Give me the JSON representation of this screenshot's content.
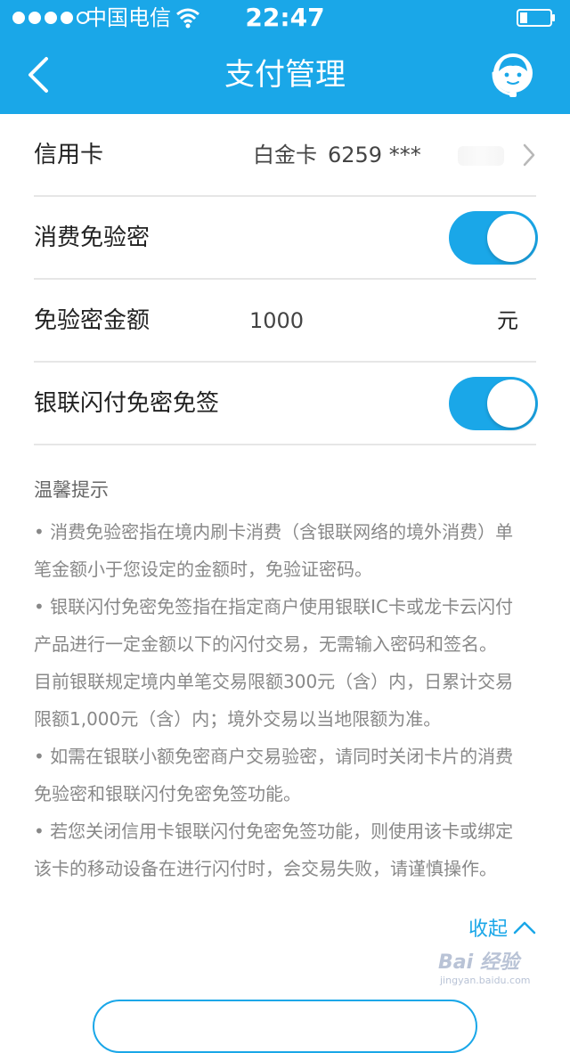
{
  "status_bar": {
    "carrier": "中国电信",
    "time": "22:47"
  },
  "nav": {
    "title": "支付管理",
    "back_icon": "chevron-left-icon",
    "service_icon": "customer-service-icon"
  },
  "settings": {
    "credit_card": {
      "label": "信用卡",
      "card_type": "白金卡",
      "card_number": "6259 ***"
    },
    "no_pin": {
      "label": "消费免验密",
      "enabled": true
    },
    "amount": {
      "label": "免验密金额",
      "value": "1000",
      "unit": "元"
    },
    "quickpass": {
      "label": "银联闪付免密免签",
      "enabled": true
    }
  },
  "tips": {
    "title": "温馨提示",
    "lines": [
      "• 消费免验密指在境内刷卡消费（含银联网络的境外消费）单",
      "笔金额小于您设定的金额时，免验证密码。",
      "• 银联闪付免密免签指在指定商户使用银联IC卡或龙卡云闪付",
      "产品进行一定金额以下的闪付交易，无需输入密码和签名。",
      "目前银联规定境内单笔交易限额300元（含）内，日累计交易",
      "限额1,000元（含）内；境外交易以当地限额为准。",
      "• 如需在银联小额免密商户交易验密，请同时关闭卡片的消费",
      "免验密和银联闪付免密免签功能。",
      "• 若您关闭信用卡银联闪付免密免签功能，则使用该卡或绑定",
      "该卡的移动设备在进行闪付时，会交易失败，请谨慎操作。"
    ]
  },
  "collapse": {
    "label": "收起"
  },
  "watermark": {
    "main": "Bai 经验",
    "sub": "jingyan.baidu.com"
  },
  "colors": {
    "accent": "#1aa7e8",
    "divider": "#e6e6e6",
    "tip_text": "#888888"
  }
}
